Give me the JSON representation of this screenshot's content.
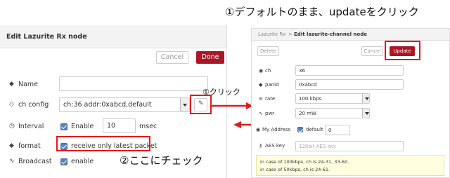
{
  "annotations": {
    "top_right": "①デフォルトのまま、updateをクリック",
    "click_label": "①クリック",
    "check_here": "②ここにチェック"
  },
  "left_panel": {
    "title": "Edit Lazurite Rx node",
    "cancel_label": "Cancel",
    "done_label": "Done",
    "rows": {
      "name": {
        "label": "Name",
        "icon": "tag-icon",
        "value": ""
      },
      "ch_config": {
        "label": "ch config",
        "icon": "gem-icon",
        "value": "ch:36 addr:0xabcd,default"
      },
      "interval": {
        "label": "Interval",
        "icon": "clock-icon",
        "checkbox_label": "Enable",
        "value": "10",
        "unit": "msec"
      },
      "format": {
        "label": "format",
        "icon": "tag-icon",
        "checkbox_label": "receive only latest packet"
      },
      "broadcast": {
        "label": "Broadcast",
        "icon": "broadcast-icon",
        "checkbox_label": "enable"
      }
    }
  },
  "right_panel": {
    "breadcrumb_parent": "Lazurite Rx",
    "breadcrumb_sep": ">",
    "title": "Edit lazurite-channel node",
    "delete_label": "Delete",
    "cancel_label": "Cancel",
    "update_label": "Update",
    "rows": {
      "ch": {
        "label": "ch",
        "value": "36"
      },
      "panid": {
        "label": "panid",
        "value": "0xabcd"
      },
      "rate": {
        "label": "rate",
        "value": "100 kbps"
      },
      "pwr": {
        "label": "pwr",
        "value": "20 mW"
      },
      "my_address": {
        "label": "My Address",
        "checkbox_label": "default",
        "value": "0"
      },
      "aes_key": {
        "label": "AES key",
        "placeholder": "128bit AES key"
      }
    },
    "info_lines": [
      "in case of 100kbps, ch is 24-31, 33-60.",
      "in case of 50kbps, ch is 24-61."
    ]
  },
  "colors": {
    "accent_red": "#ad1625",
    "highlight_red": "#e21a1a",
    "checkbox_blue": "#5b7fb7"
  }
}
